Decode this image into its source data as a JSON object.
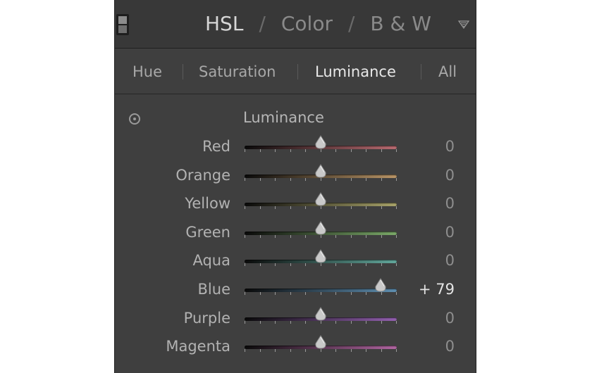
{
  "header": {
    "title_parts": [
      "HSL",
      "/",
      "Color",
      "/",
      "B & W"
    ],
    "active_part": 0,
    "collapse_icon": "triangle-down-icon"
  },
  "tabs": [
    {
      "label": "Hue",
      "active": false
    },
    {
      "label": "Saturation",
      "active": false
    },
    {
      "label": "Luminance",
      "active": true
    },
    {
      "label": "All",
      "active": false
    }
  ],
  "section": {
    "title": "Luminance",
    "target_icon": "target-adjust-icon"
  },
  "slider_range": [
    -100,
    100
  ],
  "sliders": [
    {
      "label": "Red",
      "value": 0,
      "value_text": "0",
      "color": "#b86a70"
    },
    {
      "label": "Orange",
      "value": 0,
      "value_text": "0",
      "color": "#b89466"
    },
    {
      "label": "Yellow",
      "value": 0,
      "value_text": "0",
      "color": "#a8a36a"
    },
    {
      "label": "Green",
      "value": 0,
      "value_text": "0",
      "color": "#7aa868"
    },
    {
      "label": "Aqua",
      "value": 0,
      "value_text": "0",
      "color": "#62a89c"
    },
    {
      "label": "Blue",
      "value": 79,
      "value_text": "+ 79",
      "color": "#5e8eb0"
    },
    {
      "label": "Purple",
      "value": 0,
      "value_text": "0",
      "color": "#9260ae"
    },
    {
      "label": "Magenta",
      "value": 0,
      "value_text": "0",
      "color": "#b065a0"
    }
  ]
}
